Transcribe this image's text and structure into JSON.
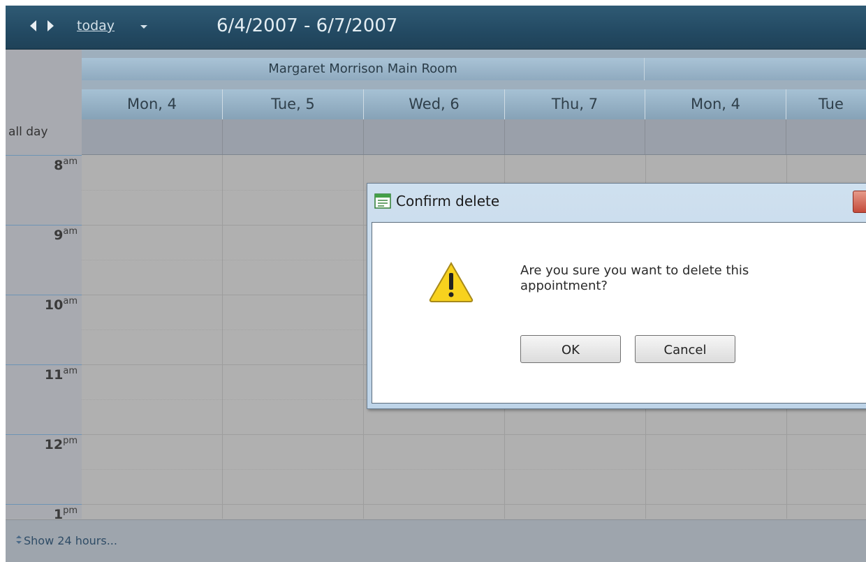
{
  "toolbar": {
    "today_label": "today",
    "date_range": "6/4/2007 - 6/7/2007"
  },
  "resources": [
    "Margaret Morrison Main Room",
    ""
  ],
  "days": [
    "Mon, 4",
    "Tue, 5",
    "Wed, 6",
    "Thu, 7",
    "Mon, 4",
    "Tue"
  ],
  "allday_label": "all day",
  "hours": [
    {
      "num": "8",
      "suffix": "am"
    },
    {
      "num": "9",
      "suffix": "am"
    },
    {
      "num": "10",
      "suffix": "am"
    },
    {
      "num": "11",
      "suffix": "am"
    },
    {
      "num": "12",
      "suffix": "pm"
    },
    {
      "num": "1",
      "suffix": "pm"
    }
  ],
  "footer": {
    "show_hours": "Show 24 hours..."
  },
  "dialog": {
    "title": "Confirm delete",
    "message": "Are you sure you want to delete this appointment?",
    "ok_label": "OK",
    "cancel_label": "Cancel"
  },
  "colors": {
    "toolbar": "#234a63",
    "header": "#8faabf",
    "dialog_frame": "#bed4e8",
    "link": "#2f4c66"
  }
}
